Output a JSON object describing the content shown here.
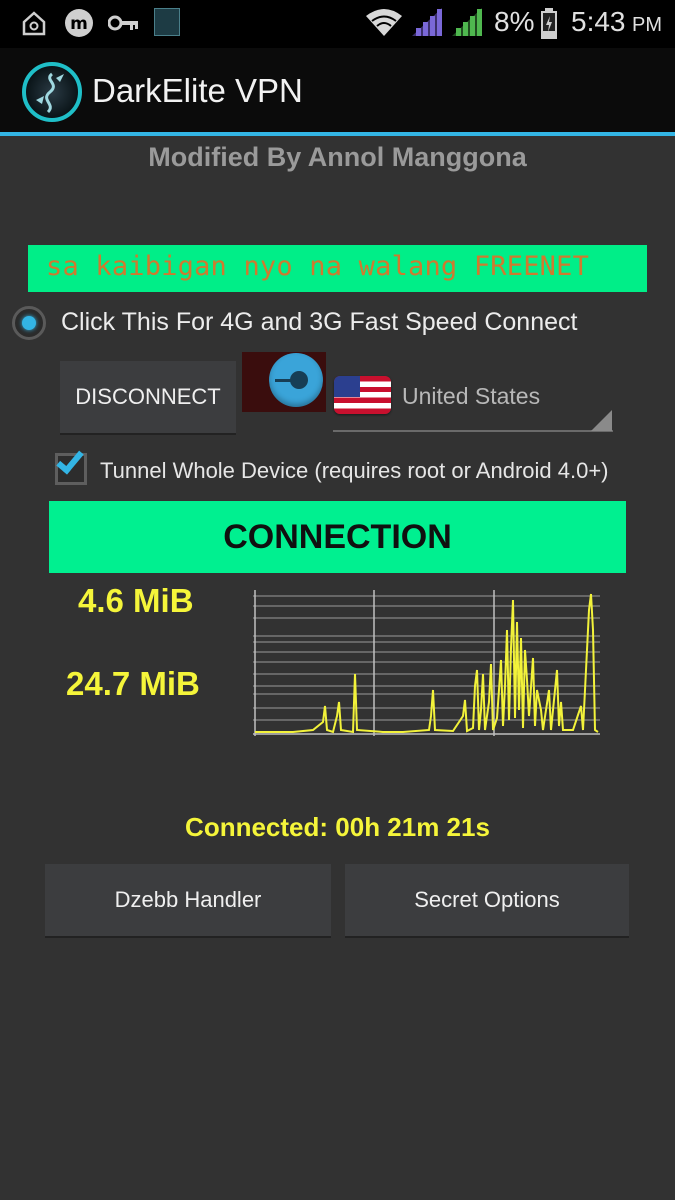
{
  "status_bar": {
    "icons": [
      "home-icon",
      "m-icon",
      "key-icon",
      "app-thumbnail-icon",
      "wifi-icon",
      "signal-purple-icon",
      "signal-green-icon",
      "battery-icon"
    ],
    "battery": "8%",
    "time": "5:43",
    "ampm": "PM"
  },
  "app": {
    "title": "DarkElite VPN",
    "logo": "dragon-logo-icon"
  },
  "modified_by": "Modified By Annol Manggona",
  "banner": {
    "text": "sa kaibigan nyo na walang FREENET",
    "bg_color": "#00ee88",
    "text_color": "#cf7a2f"
  },
  "radio": {
    "label": "Click This For 4G and 3G Fast Speed Connect",
    "selected": true
  },
  "disconnect_label": "DISCONNECT",
  "power_icon": "power-toggle-icon",
  "country": {
    "flag": "us-flag-icon",
    "name": "United States"
  },
  "tunnel": {
    "label": "Tunnel Whole Device (requires root or Android 4.0+)",
    "checked": true
  },
  "connection_label": "CONNECTION",
  "stats": {
    "upload": "4.6 MiB",
    "download": "24.7 MiB"
  },
  "connected_text": "Connected: 00h 21m 21s",
  "buttons": {
    "handler": "Dzebb Handler",
    "secret": "Secret Options"
  },
  "colors": {
    "accent": "#33b5e5",
    "green": "#00f090",
    "yellow": "#f5f53a",
    "graph_line": "#f2f23a"
  }
}
